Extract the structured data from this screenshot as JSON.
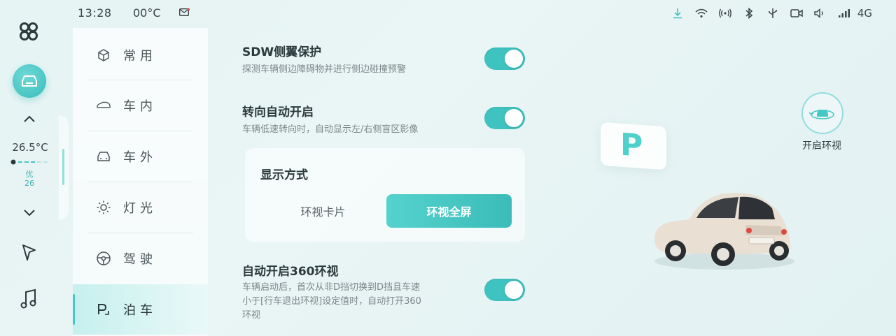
{
  "status_bar": {
    "time": "13:28",
    "outside_temp": "00°C",
    "network": "4G",
    "icons": [
      "download-icon",
      "wifi-icon",
      "hotspot-icon",
      "bluetooth-icon",
      "usb-icon",
      "camera-icon",
      "volume-icon",
      "signal-icon"
    ]
  },
  "rail": {
    "temperature": "26.5°C",
    "air_quality_label": "优",
    "air_quality_value": "26"
  },
  "menu": {
    "items": [
      {
        "label": "常用",
        "icon": "cube-icon"
      },
      {
        "label": "车内",
        "icon": "car-interior-icon"
      },
      {
        "label": "车外",
        "icon": "car-exterior-icon"
      },
      {
        "label": "灯光",
        "icon": "sun-icon"
      },
      {
        "label": "驾驶",
        "icon": "steering-wheel-icon"
      },
      {
        "label": "泊车",
        "icon": "parking-icon"
      }
    ],
    "active_index": 5
  },
  "settings": {
    "sdw": {
      "title": "SDW侧翼保护",
      "desc": "探测车辆侧边障碍物并进行侧边碰撞预警",
      "enabled": true
    },
    "turn_auto": {
      "title": "转向自动开启",
      "desc": "车辆低速转向时，自动显示左/右侧盲区影像",
      "enabled": true
    },
    "display_mode": {
      "title": "显示方式",
      "options": [
        "环视卡片",
        "环视全屏"
      ],
      "selected": "环视全屏"
    },
    "auto_360": {
      "title": "自动开启360环视",
      "desc_line1": "车辆启动后，首次从非D挡切换到D挡且车速",
      "desc_line2": "小于[行车退出环视]设定值时，自动打开360",
      "desc_line3": "环视",
      "enabled": true
    }
  },
  "illustration": {
    "parking_sign": "P",
    "surround_view_label": "开启环视"
  },
  "colors": {
    "accent": "#3fc3c0",
    "text_primary": "#2b3a3c",
    "text_secondary": "#7c8789"
  }
}
